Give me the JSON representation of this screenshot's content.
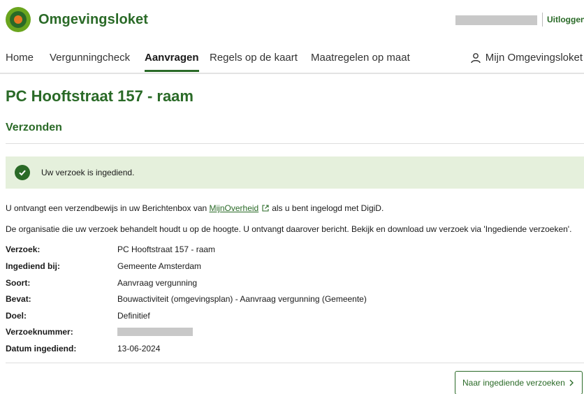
{
  "header": {
    "brand": "Omgevingsloket",
    "logout_label": "Uitloggen"
  },
  "nav": {
    "items": [
      {
        "label": "Home",
        "active": false
      },
      {
        "label": "Vergunningcheck",
        "active": false
      },
      {
        "label": "Aanvragen",
        "active": true
      },
      {
        "label": "Regels op de kaart",
        "active": false
      },
      {
        "label": "Maatregelen op maat",
        "active": false
      }
    ],
    "account_label": "Mijn Omgevingsloket",
    "account_icon": "user-icon"
  },
  "page": {
    "title": "PC Hooftstraat 157 - raam",
    "status_heading": "Verzonden"
  },
  "alert": {
    "icon": "check-circle-icon",
    "text": "Uw verzoek is ingediend."
  },
  "info": {
    "p1_before": "U ontvangt een verzendbewijs in uw Berichtenbox van",
    "p1_link": "MijnOverheid",
    "p1_after": "als u bent ingelogd met DigiD.",
    "p2": "De organisatie die uw verzoek behandelt houdt u op de hoogte. U ontvangt daarover bericht. Bekijk en download uw verzoek via 'Ingediende verzoeken'."
  },
  "details": [
    {
      "label": "Verzoek:",
      "value": "PC Hooftstraat 157 - raam"
    },
    {
      "label": "Ingediend bij:",
      "value": "Gemeente Amsterdam"
    },
    {
      "label": "Soort:",
      "value": "Aanvraag vergunning"
    },
    {
      "label": "Bevat:",
      "value": "Bouwactiviteit (omgevingsplan) - Aanvraag vergunning (Gemeente)"
    },
    {
      "label": "Doel:",
      "value": "Definitief"
    },
    {
      "label": "Verzoeknummer:",
      "value": ""
    },
    {
      "label": "Datum ingediend:",
      "value": "13-06-2024"
    }
  ],
  "actions": {
    "next_label": "Naar ingediende verzoeken"
  },
  "colors": {
    "brand_green": "#2a6a27",
    "light_green": "#6aa51e",
    "accent_orange": "#e87722",
    "alert_bg": "#e5f0dc"
  }
}
